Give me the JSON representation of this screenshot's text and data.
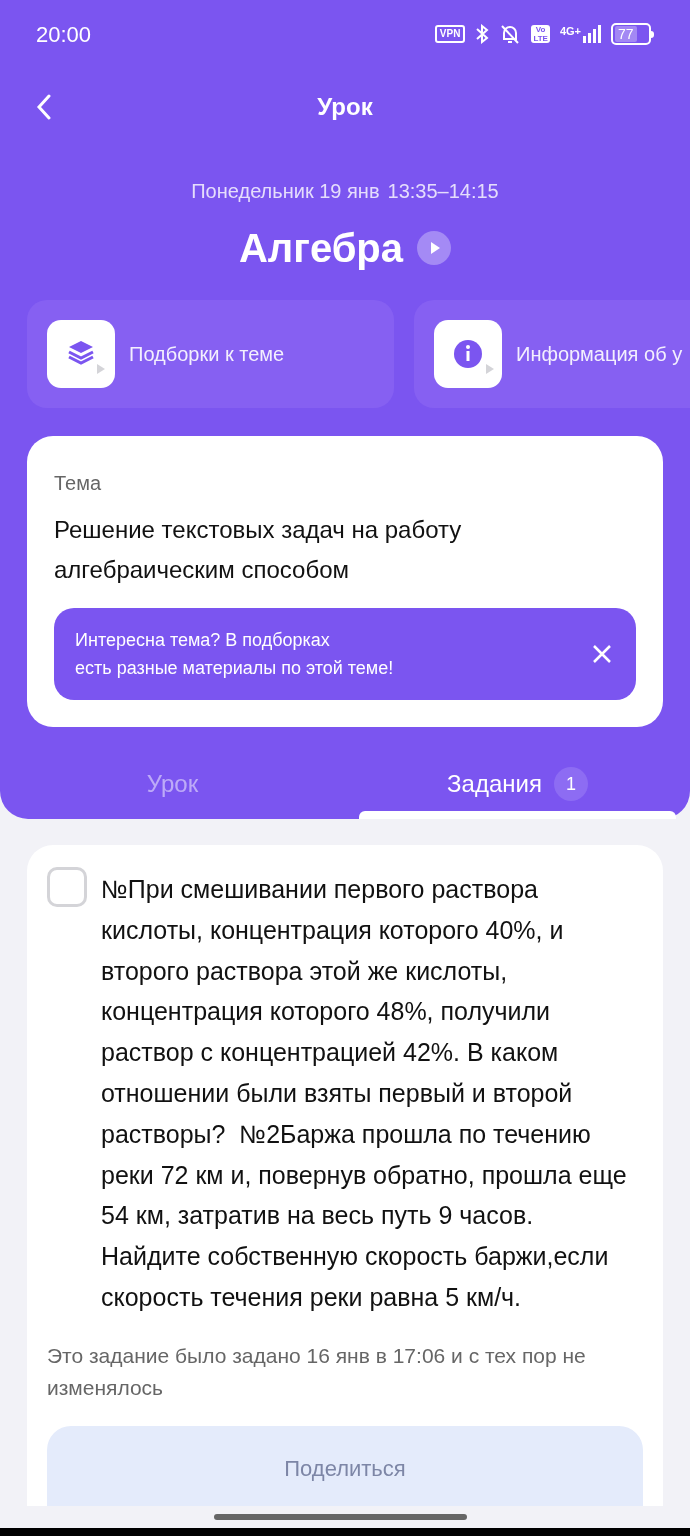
{
  "status_bar": {
    "time": "20:00",
    "vpn": "VPN",
    "volte_top": "Vo",
    "volte_bottom": "LTE",
    "network": "4G+",
    "battery": "77"
  },
  "header": {
    "title": "Урок",
    "date": "Понедельник 19 янв",
    "time": "13:35–14:15",
    "subject": "Алгебра"
  },
  "quick_cards": [
    {
      "kind": "collections",
      "label": "Подборки к теме"
    },
    {
      "kind": "info",
      "label": "Информация об у"
    }
  ],
  "topic": {
    "caption": "Тема",
    "text": "Решение текстовых задач на работу алгебраическим способом",
    "banner": "Интересна тема? В подборках\nесть разные материалы по этой теме!"
  },
  "tabs": [
    {
      "label": "Урок",
      "selected": false
    },
    {
      "label": "Задания",
      "selected": true,
      "badge": "1"
    }
  ],
  "task": {
    "checked": false,
    "text": "№При смешивании первого раствора кислоты, концентрация которого 40%, и второго раствора этой же кислоты, концентрация которого 48%, получили раствор с концентрацией 42%. В каком отношении были взяты первый и второй растворы?  №2Баржа прошла по течению реки 72 км и, повернув обратно, прошла еще 54 км, затратив на весь путь 9 часов. Найдите собственную скорость баржи,если скорость течения реки равна 5 км/ч.",
    "note": "Это задание было задано 16 янв в 17:06 и с тех пор не изменялось",
    "button": "Поделиться"
  }
}
